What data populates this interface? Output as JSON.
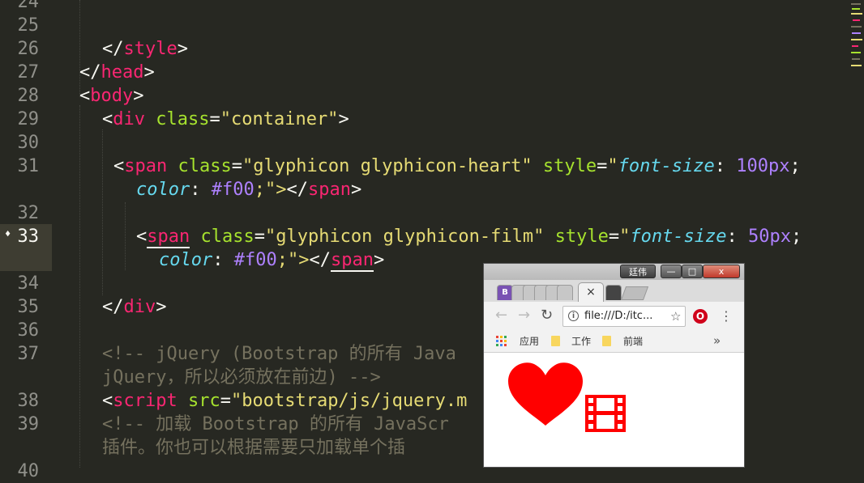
{
  "editor": {
    "line_numbers": [
      "24",
      "25",
      "26",
      "27",
      "28",
      "29",
      "30",
      "31",
      "32",
      "33",
      "34",
      "35",
      "36",
      "37",
      "38",
      "39",
      "40"
    ],
    "lines": {
      "l26": {
        "open": "</",
        "name": "style",
        "close": ">"
      },
      "l27": {
        "open": "</",
        "name": "head",
        "close": ">"
      },
      "l28": {
        "open": "<",
        "name": "body",
        "close": ">"
      },
      "l29": {
        "open": "<",
        "name": "div",
        "attr": "class",
        "eq": "=",
        "val": "\"container\"",
        "close": ">"
      },
      "l31a": {
        "open": "<",
        "name": "span",
        "attr": "class",
        "eq": "=",
        "val": "\"glyphicon glyphicon-heart\"",
        "attr2": "style",
        "eq2": "=",
        "q": "\"",
        "prop": "font-size",
        "colon": ": ",
        "num": "100px",
        "semi": ";"
      },
      "l31b": {
        "prop": "color",
        "colon": ": ",
        "num": "#f00",
        "rest": ";\">",
        "etag": "</",
        "ename": "span",
        "eclose": ">"
      },
      "l33a": {
        "open": "<",
        "name": "span",
        "attr": "class",
        "eq": "=",
        "val": "\"glyphicon glyphicon-film\"",
        "attr2": "style",
        "eq2": "=",
        "q": "\"",
        "prop": "font-size",
        "colon": ": ",
        "num": "50px",
        "semi": ";"
      },
      "l33b": {
        "prop": "color",
        "colon": ": ",
        "num": "#f00",
        "rest": ";\">",
        "etag": "</",
        "ename": "span",
        "eclose": ">"
      },
      "l35": {
        "open": "</",
        "name": "div",
        "close": ">"
      },
      "l37a": {
        "comment": "<!-- jQuery (Bootstrap 的所有 Java"
      },
      "l37b": {
        "comment": "jQuery，所以必须放在前边) -->"
      },
      "l38": {
        "open": "<",
        "name": "script",
        "attr": "src",
        "eq": "=",
        "val": "\"bootstrap/js/jquery.m"
      },
      "l39a": {
        "comment": "<!-- 加载 Bootstrap 的所有 JavaScr"
      },
      "l39b": {
        "comment": "插件。你也可以根据需要只加载单个插"
      }
    }
  },
  "browser": {
    "user_label": "廷伟",
    "window_buttons": {
      "minimize": "—",
      "maximize": "□",
      "close": "x"
    },
    "tab_close": "×",
    "bootstrap_tab": "B",
    "url": "file:///D:/itc...",
    "info_glyph": "i",
    "bookmarks": [
      "应用",
      "工作",
      "前端"
    ],
    "more": "»",
    "page": {
      "heart_color": "#ff0000",
      "film_color": "#ff0000"
    }
  },
  "colors": {
    "bg": "#272822",
    "tag": "#f92672",
    "attr": "#a6e22e",
    "string": "#e6db74",
    "number": "#ae81ff",
    "property": "#66d9ef",
    "comment": "#75715e"
  }
}
